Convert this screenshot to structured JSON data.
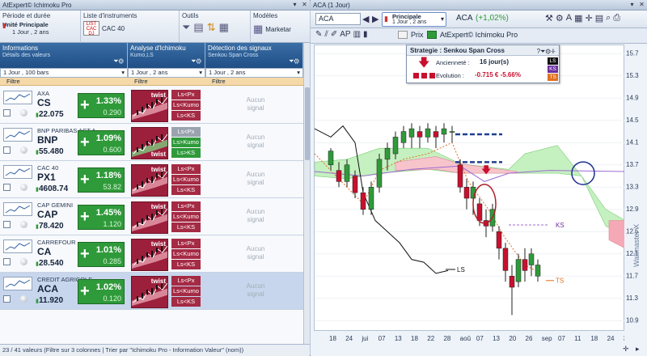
{
  "left_title": "AtExpert© Ichimoku Pro",
  "right_title": "ACA (1 Jour)",
  "toolbar": {
    "period_header": "Période et durée",
    "unit_label": "Unité Principale",
    "unit_value": "1 Jour , 2 ans",
    "list_header": "Liste d'instruments",
    "list_value": "CAC 40",
    "tools_header": "Outils",
    "models_header": "Modèles",
    "models_value": "Marketar"
  },
  "columns": {
    "info": {
      "title": "Informations",
      "sub": "Détails des valeurs",
      "select": "1 Jour , 100 bars",
      "filter": "Filtre"
    },
    "analysis": {
      "title": "Analyse d'Ichimoku",
      "sub": "Kumo,LS",
      "select": "1 Jour , 2 ans",
      "filter": "Filtre"
    },
    "signals": {
      "title": "Détection des signaux",
      "sub": "Senkou Span Cross",
      "select": "1 Jour , 2 ans",
      "filter": "Filtre"
    }
  },
  "rows": [
    {
      "name": "AXA",
      "ticker": "CS",
      "price": "22.075",
      "pct": "1.33%",
      "abs": "0.290",
      "tags": [
        "Ls<Px",
        "Ls<Kumo",
        "Ls<KS"
      ],
      "tagc": [
        "r",
        "r",
        "r"
      ],
      "signal1": "Aucun",
      "signal2": "signal"
    },
    {
      "name": "BNP PARIBAS ACT.A",
      "ticker": "BNP",
      "price": "55.480",
      "pct": "1.09%",
      "abs": "0.600",
      "tags": [
        "Ls<Px",
        "Ls>Kumo",
        "Ls>KS"
      ],
      "tagc": [
        "gr",
        "g",
        "g"
      ],
      "signal1": "Aucun",
      "signal2": "signal"
    },
    {
      "name": "CAC 40",
      "ticker": "PX1",
      "price": "4608.74",
      "pct": "1.18%",
      "abs": "53.82",
      "tags": [
        "Ls<Px",
        "Ls<Kumo",
        "Ls<KS"
      ],
      "tagc": [
        "r",
        "r",
        "r"
      ],
      "signal1": "Aucun",
      "signal2": "signal"
    },
    {
      "name": "CAP GEMINI",
      "ticker": "CAP",
      "price": "78.420",
      "pct": "1.45%",
      "abs": "1.120",
      "tags": [
        "Ls<Px",
        "Ls<Kumo",
        "Ls<KS"
      ],
      "tagc": [
        "r",
        "r",
        "r"
      ],
      "signal1": "Aucun",
      "signal2": "signal"
    },
    {
      "name": "CARREFOUR",
      "ticker": "CA",
      "price": "28.540",
      "pct": "1.01%",
      "abs": "0.285",
      "tags": [
        "Ls<Px",
        "Ls<Kumo",
        "Ls<KS"
      ],
      "tagc": [
        "r",
        "r",
        "r"
      ],
      "signal1": "Aucun",
      "signal2": "signal"
    },
    {
      "name": "CREDIT AGRICOLE",
      "ticker": "ACA",
      "price": "11.920",
      "pct": "1.02%",
      "abs": "0.120",
      "tags": [
        "Ls<Px",
        "Ls<Kumo",
        "Ls<KS"
      ],
      "tagc": [
        "r",
        "r",
        "r"
      ],
      "signal1": "Aucun",
      "signal2": "signal"
    }
  ],
  "twist_label": "twist",
  "status_text": "23 / 41 valeurs (Filtre sur 3 colonnes | Trier par \"Ichimoku Pro - Information Valeur\" (nom))",
  "chart_toolbar": {
    "symbol": "ACA",
    "unit_label": "Principale",
    "unit_value": "1 Jour , 2 ans",
    "quote_symbol": "ACA",
    "quote_change": "(+1,02%)",
    "prix_label": "Prix",
    "indicator": "AtExpert© Ichimoku Pro"
  },
  "strategy": {
    "title": "Strategie : Senkou Span Cross",
    "age_label": "Ancienneté :",
    "age_value": "16 jour(s)",
    "evo_label": "Evolution :",
    "evo_value": "-0.715 € -5.66%",
    "badges": [
      "LS",
      "KS",
      "TS"
    ]
  },
  "chart_labels": {
    "ls1": "LS",
    "ks": "KS",
    "ts": "TS"
  },
  "watermark": "Wallmaster X",
  "chart_data": {
    "type": "line",
    "yticks": [
      15.7,
      15.3,
      14.9,
      14.5,
      14.1,
      13.7,
      13.3,
      12.9,
      12.5,
      12.1,
      11.7,
      11.3,
      10.9
    ],
    "ylim": [
      10.7,
      15.85
    ],
    "xticks": [
      "18",
      "24",
      "jui",
      "07",
      "13",
      "18",
      "22",
      "28",
      "aoû",
      "07",
      "13",
      "20",
      "26",
      "sep",
      "07",
      "11",
      "18",
      "24",
      "30"
    ],
    "current_price": 11.92
  }
}
